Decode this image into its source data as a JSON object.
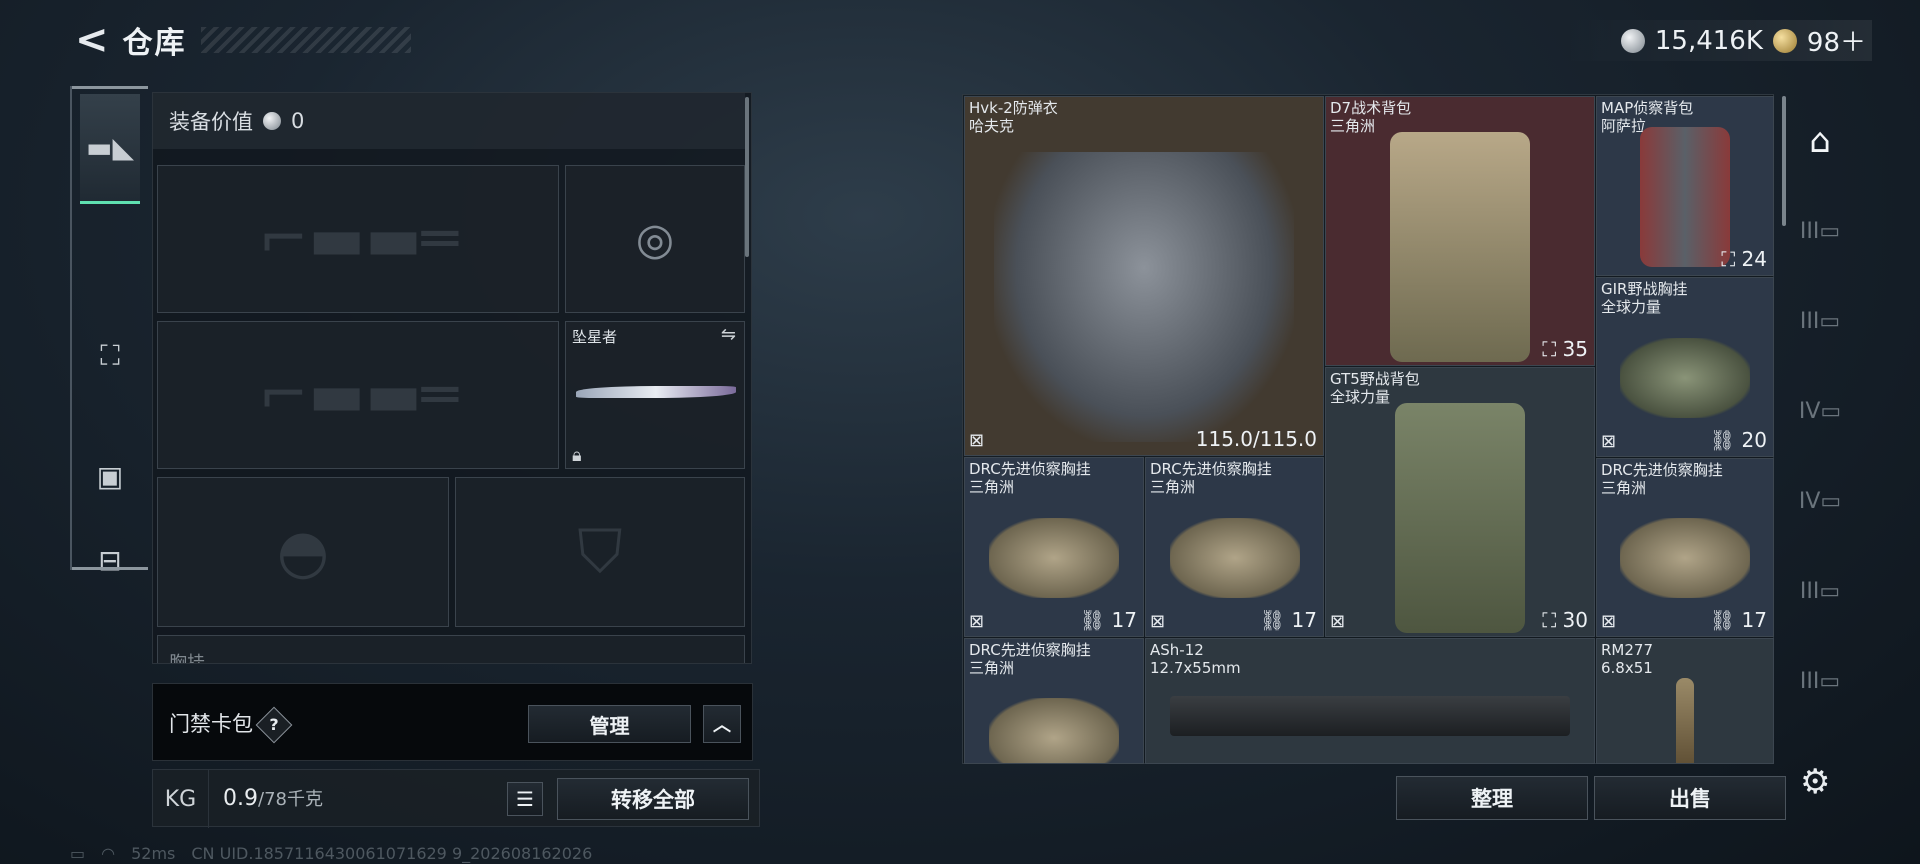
{
  "header": {
    "title": "仓库"
  },
  "currency": {
    "silver": "15,416K",
    "gold": "98＋"
  },
  "left_panel": {
    "equip_value_label": "装备价值",
    "equip_value": "0",
    "melee_slot_name": "坠星者",
    "chest_label": "胸挂"
  },
  "card_bag": {
    "label": "门禁卡包",
    "help": "?",
    "manage": "管理"
  },
  "weight": {
    "current": "0.9",
    "max": "/78千克",
    "kg_icon": "KG",
    "transfer_all": "转移全部"
  },
  "footer": {
    "ping": "52ms",
    "uid": "CN UID.1857116430061071629 9_202608162026"
  },
  "stash": {
    "items": [
      {
        "name": "Hvk-2防弹衣",
        "sub": "哈夫克",
        "value": "115.0/115.0"
      },
      {
        "name": "D7战术背包",
        "sub": "三角洲",
        "count": "35"
      },
      {
        "name": "MAP侦察背包",
        "sub": "阿萨拉",
        "count": "24"
      },
      {
        "name": "GIR野战胸挂",
        "sub": "全球力量",
        "count": "20"
      },
      {
        "name": "GT5野战背包",
        "sub": "全球力量",
        "count": "30"
      },
      {
        "name": "DRC先进侦察胸挂",
        "sub": "三角洲",
        "count": "17"
      },
      {
        "name": "DRC先进侦察胸挂",
        "sub": "三角洲",
        "count": "17"
      },
      {
        "name": "DRC先进侦察胸挂",
        "sub": "三角洲",
        "count": "17"
      },
      {
        "name": "DRC先进侦察胸挂",
        "sub": "三角洲"
      },
      {
        "name": "ASh-12",
        "sub": "12.7x55mm"
      },
      {
        "name": "RM277",
        "sub": "6.8x51"
      }
    ],
    "sort_button": "整理",
    "sell_button": "出售"
  },
  "sidebar_tabs": [
    "III",
    "III",
    "IV",
    "IV",
    "III",
    "III"
  ]
}
